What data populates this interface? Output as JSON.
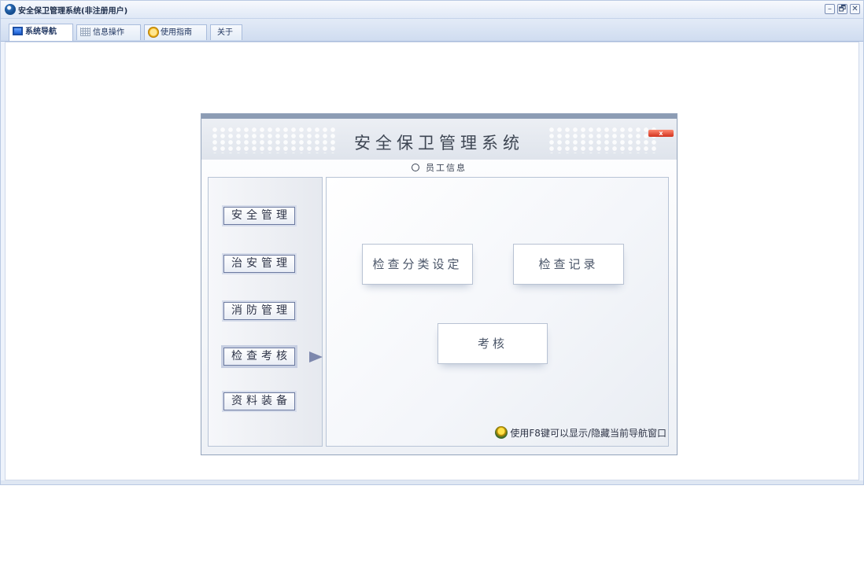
{
  "window": {
    "title": "安全保卫管理系统(非注册用户)",
    "controls": {
      "minimize": "–",
      "restore": "🗗",
      "close": "✕"
    }
  },
  "tabs": [
    {
      "label": "系统导航",
      "icon": "monitor-icon",
      "active": true
    },
    {
      "label": "信息操作",
      "icon": "grid-icon",
      "active": false
    },
    {
      "label": "使用指南",
      "icon": "bulb-icon",
      "active": false
    },
    {
      "label": "关于",
      "active": false
    }
  ],
  "dialog": {
    "title": "安全保卫管理系统",
    "close_label": "x",
    "employee_info": "员工信息",
    "left_menu": [
      {
        "label": "安全管理"
      },
      {
        "label": "治安管理"
      },
      {
        "label": "消防管理"
      },
      {
        "label": "检查考核",
        "selected": true
      },
      {
        "label": "资料装备"
      }
    ],
    "function_buttons": {
      "category": "检查分类设定",
      "records": "检查记录",
      "assess": "考核"
    },
    "hint": "使用F8键可以显示/隐藏当前导航窗口"
  },
  "colors": {
    "title_accent": "#1d2d4a",
    "dialog_border": "#8c9cb4",
    "close_button": "#d2321d"
  }
}
